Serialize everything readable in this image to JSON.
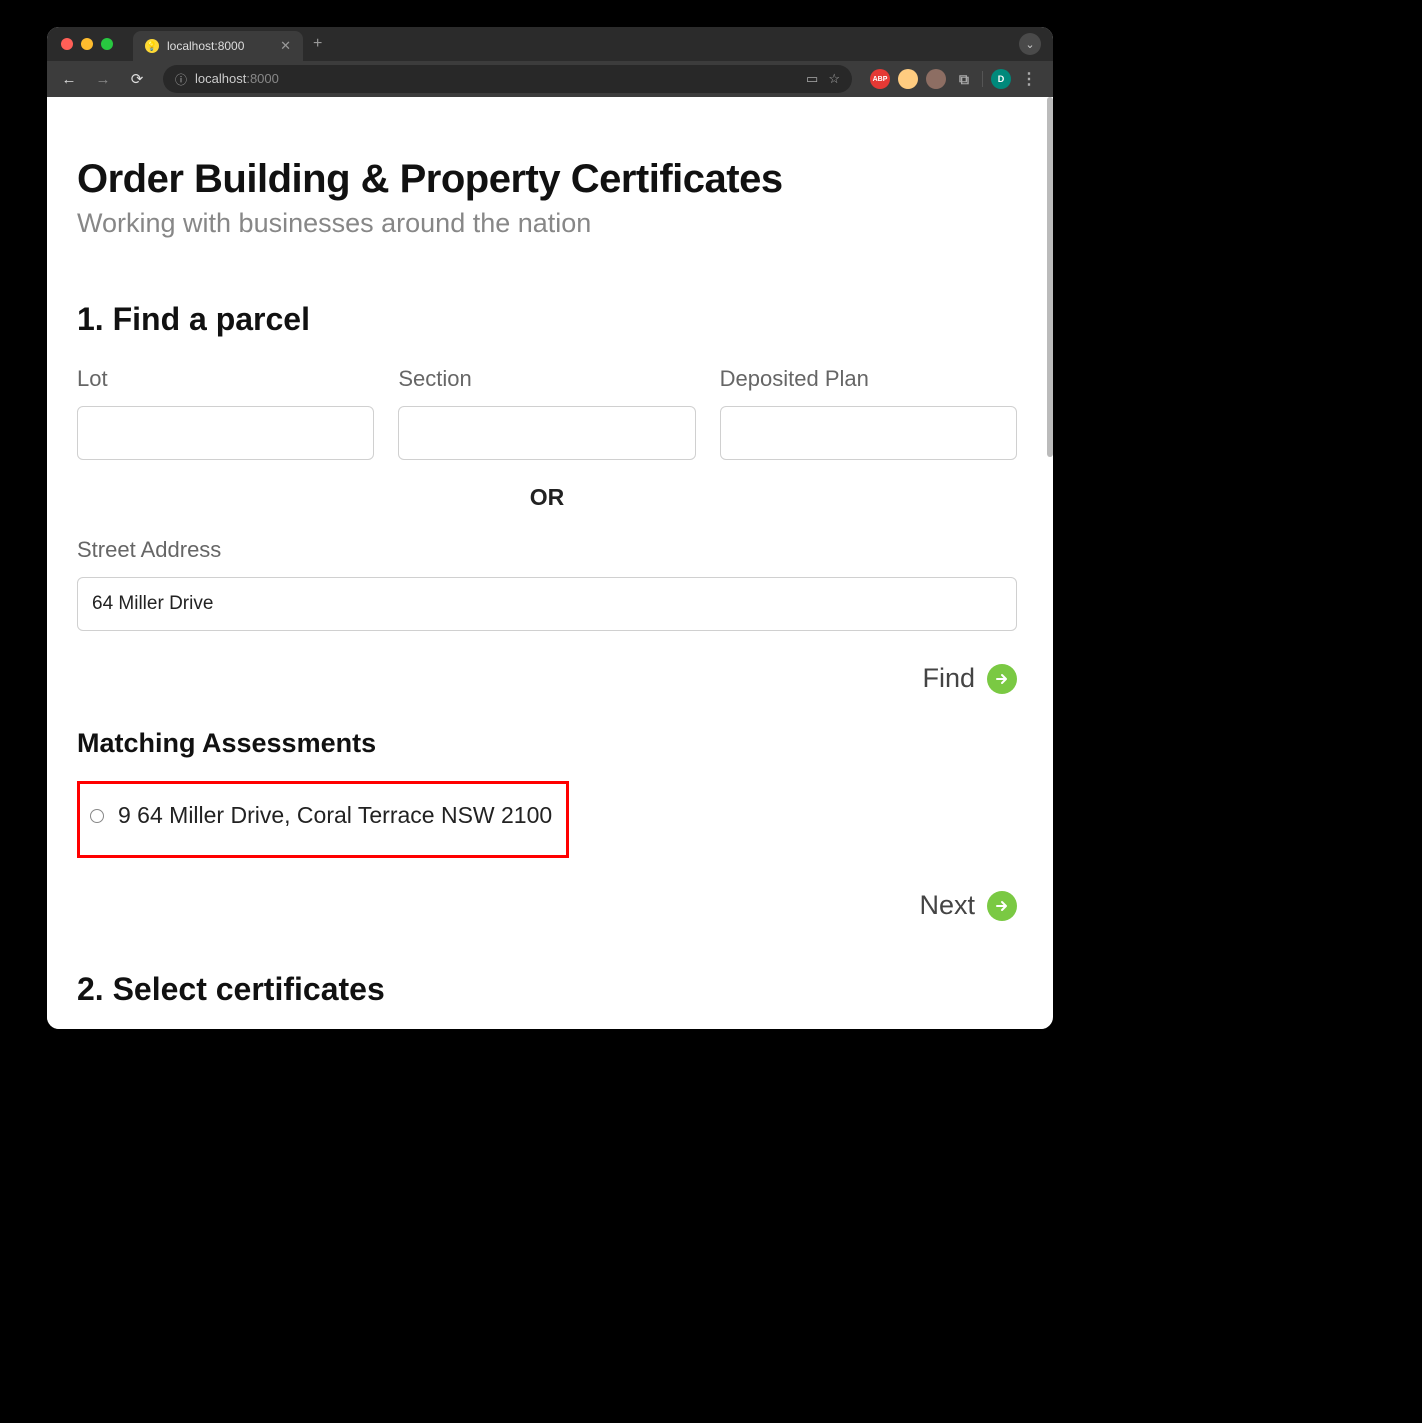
{
  "browser": {
    "tab_title": "localhost:8000",
    "url_host": "localhost",
    "url_port": ":8000"
  },
  "page": {
    "title": "Order Building & Property Certificates",
    "subtitle": "Working with businesses around the nation"
  },
  "section1": {
    "title": "1. Find a parcel",
    "fields": {
      "lot_label": "Lot",
      "lot_value": "",
      "section_label": "Section",
      "section_value": "",
      "dp_label": "Deposited Plan",
      "dp_value": "",
      "or": "OR",
      "street_label": "Street Address",
      "street_value": "64 Miller Drive"
    },
    "find_label": "Find",
    "matching_title": "Matching Assessments",
    "assessments": [
      {
        "text": "9 64 Miller Drive, Coral Terrace NSW 2100"
      }
    ],
    "next_label": "Next"
  },
  "section2": {
    "title": "2. Select certificates"
  }
}
